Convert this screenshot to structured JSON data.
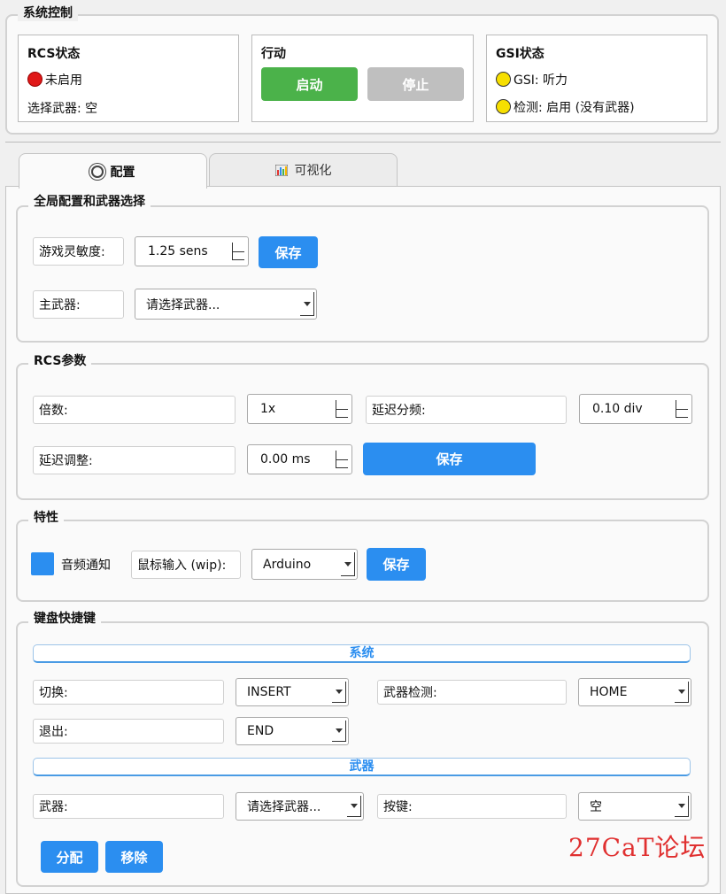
{
  "system_control": {
    "title": "系统控制",
    "rcs": {
      "title": "RCS状态",
      "status": "未启用",
      "weapon": "选择武器: 空"
    },
    "action": {
      "title": "行动",
      "start": "启动",
      "stop": "停止"
    },
    "gsi": {
      "title": "GSI状态",
      "line1": "GSI: 听力",
      "line2": "检测: 启用 (没有武器)"
    }
  },
  "tabs": [
    {
      "label": "配置",
      "icon": "gear-icon"
    },
    {
      "label": "可视化",
      "icon": "chart-icon"
    }
  ],
  "global": {
    "title": "全局配置和武器选择",
    "sens_label": "游戏灵敏度:",
    "sens_value": "1.25 sens",
    "save": "保存",
    "weapon_label": "主武器:",
    "weapon_value": "请选择武器..."
  },
  "rcs_params": {
    "title": "RCS参数",
    "multiplier_label": "倍数:",
    "multiplier_value": "1x",
    "delay_div_label": "延迟分频:",
    "delay_div_value": "0.10 div",
    "delay_adj_label": "延迟调整:",
    "delay_adj_value": "0.00 ms",
    "save": "保存"
  },
  "features": {
    "title": "特性",
    "audio_label": "音频通知",
    "mouse_label": "鼠标输入 (wip):",
    "mouse_value": "Arduino",
    "save": "保存"
  },
  "hotkeys": {
    "title": "键盘快捷键",
    "system_section": "系统",
    "toggle_label": "切换:",
    "toggle_value": "INSERT",
    "detect_label": "武器检测:",
    "detect_value": "HOME",
    "exit_label": "退出:",
    "exit_value": "END",
    "weapon_section": "武器",
    "weapon_label": "武器:",
    "weapon_value": "请选择武器...",
    "key_label": "按键:",
    "key_value": "空",
    "assign": "分配",
    "remove": "移除"
  },
  "watermark": "27CaT论坛",
  "colors": {
    "accent": "#2b8ef0",
    "start": "#4bb24a",
    "stop": "#bfbfbf",
    "status_off": "#e01818",
    "status_warn": "#f7df00",
    "watermark": "#e03030"
  }
}
